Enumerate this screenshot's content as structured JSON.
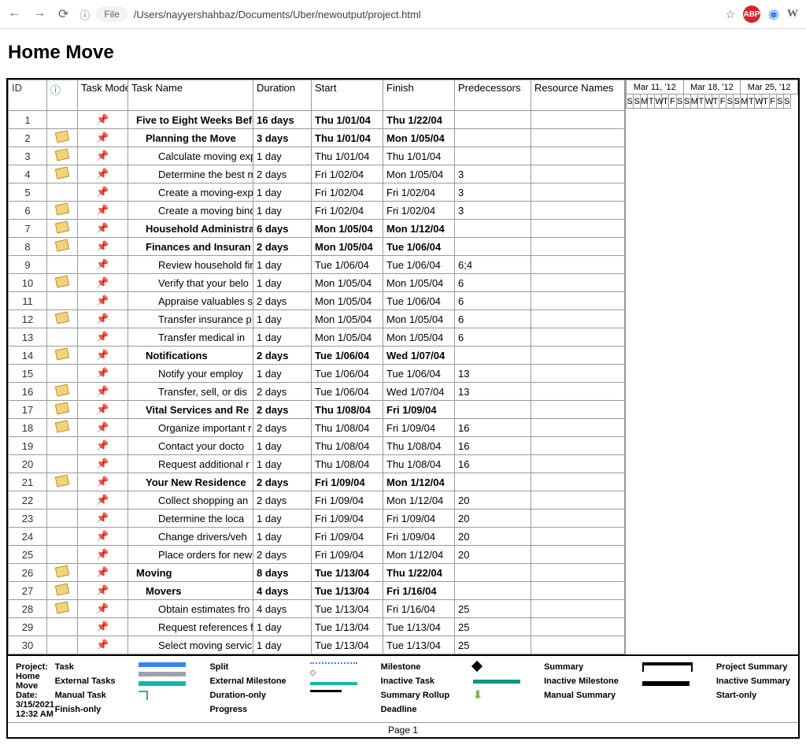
{
  "browser": {
    "file_chip": "File",
    "url": "/Users/nayyershahbaz/Documents/Uber/newoutput/project.html",
    "ext_abp": "ABP",
    "ext_w": "W"
  },
  "title": "Home Move",
  "columns": {
    "id": "ID",
    "info": "ⓘ",
    "mode": "Task Mode",
    "name": "Task Name",
    "duration": "Duration",
    "start": "Start",
    "finish": "Finish",
    "pred": "Predecessors",
    "res": "Resource Names"
  },
  "timeline": {
    "weeks": [
      "Mar 11, '12",
      "Mar 18, '12",
      "Mar 25, '12"
    ],
    "days": [
      "S",
      "S",
      "M",
      "T",
      "W",
      "T",
      "F",
      "S",
      "S",
      "M",
      "T",
      "W",
      "T",
      "F",
      "S",
      "S",
      "M",
      "T",
      "W",
      "T",
      "F",
      "S",
      "S"
    ]
  },
  "rows": [
    {
      "id": "1",
      "note": false,
      "bold": true,
      "indent": 1,
      "name": "Five to Eight Weeks Befo",
      "dur": "16 days",
      "start": "Thu 1/01/04",
      "finish": "Thu 1/22/04",
      "pred": ""
    },
    {
      "id": "2",
      "note": true,
      "bold": true,
      "indent": 2,
      "name": "Planning the Move",
      "dur": "3 days",
      "start": "Thu 1/01/04",
      "finish": "Mon 1/05/04",
      "pred": ""
    },
    {
      "id": "3",
      "note": true,
      "bold": false,
      "indent": 3,
      "name": "Calculate moving exp",
      "dur": "1 day",
      "start": "Thu 1/01/04",
      "finish": "Thu 1/01/04",
      "pred": ""
    },
    {
      "id": "4",
      "note": true,
      "bold": false,
      "indent": 3,
      "name": "Determine the best m",
      "dur": "2 days",
      "start": "Fri 1/02/04",
      "finish": "Mon 1/05/04",
      "pred": "3"
    },
    {
      "id": "5",
      "note": false,
      "bold": false,
      "indent": 3,
      "name": "Create a moving-expe",
      "dur": "1 day",
      "start": "Fri 1/02/04",
      "finish": "Fri 1/02/04",
      "pred": "3"
    },
    {
      "id": "6",
      "note": true,
      "bold": false,
      "indent": 3,
      "name": "Create a moving bind",
      "dur": "1 day",
      "start": "Fri 1/02/04",
      "finish": "Fri 1/02/04",
      "pred": "3"
    },
    {
      "id": "7",
      "note": true,
      "bold": true,
      "indent": 2,
      "name": "Household Administratio",
      "dur": "6 days",
      "start": "Mon 1/05/04",
      "finish": "Mon 1/12/04",
      "pred": ""
    },
    {
      "id": "8",
      "note": true,
      "bold": true,
      "indent": 2,
      "name": "Finances and Insuran",
      "dur": "2 days",
      "start": "Mon 1/05/04",
      "finish": "Tue 1/06/04",
      "pred": ""
    },
    {
      "id": "9",
      "note": false,
      "bold": false,
      "indent": 3,
      "name": "Review household fin",
      "dur": "1 day",
      "start": "Tue 1/06/04",
      "finish": "Tue 1/06/04",
      "pred": "6;4"
    },
    {
      "id": "10",
      "note": true,
      "bold": false,
      "indent": 3,
      "name": "Verify that your belo",
      "dur": "1 day",
      "start": "Mon 1/05/04",
      "finish": "Mon 1/05/04",
      "pred": "6"
    },
    {
      "id": "11",
      "note": false,
      "bold": false,
      "indent": 3,
      "name": "Appraise valuables s",
      "dur": "2 days",
      "start": "Mon 1/05/04",
      "finish": "Tue 1/06/04",
      "pred": "6"
    },
    {
      "id": "12",
      "note": true,
      "bold": false,
      "indent": 3,
      "name": "Transfer insurance p",
      "dur": "1 day",
      "start": "Mon 1/05/04",
      "finish": "Mon 1/05/04",
      "pred": "6"
    },
    {
      "id": "13",
      "note": false,
      "bold": false,
      "indent": 3,
      "name": "Transfer medical in",
      "dur": "1 day",
      "start": "Mon 1/05/04",
      "finish": "Mon 1/05/04",
      "pred": "6"
    },
    {
      "id": "14",
      "note": true,
      "bold": true,
      "indent": 2,
      "name": "Notifications",
      "dur": "2 days",
      "start": "Tue 1/06/04",
      "finish": "Wed 1/07/04",
      "pred": ""
    },
    {
      "id": "15",
      "note": false,
      "bold": false,
      "indent": 3,
      "name": "Notify your employ",
      "dur": "1 day",
      "start": "Tue 1/06/04",
      "finish": "Tue 1/06/04",
      "pred": "13"
    },
    {
      "id": "16",
      "note": true,
      "bold": false,
      "indent": 3,
      "name": "Transfer, sell, or dis",
      "dur": "2 days",
      "start": "Tue 1/06/04",
      "finish": "Wed 1/07/04",
      "pred": "13"
    },
    {
      "id": "17",
      "note": true,
      "bold": true,
      "indent": 2,
      "name": "Vital Services and Re",
      "dur": "2 days",
      "start": "Thu 1/08/04",
      "finish": "Fri 1/09/04",
      "pred": ""
    },
    {
      "id": "18",
      "note": true,
      "bold": false,
      "indent": 3,
      "name": "Organize important r",
      "dur": "2 days",
      "start": "Thu 1/08/04",
      "finish": "Fri 1/09/04",
      "pred": "16"
    },
    {
      "id": "19",
      "note": false,
      "bold": false,
      "indent": 3,
      "name": "Contact your docto",
      "dur": "1 day",
      "start": "Thu 1/08/04",
      "finish": "Thu 1/08/04",
      "pred": "16"
    },
    {
      "id": "20",
      "note": false,
      "bold": false,
      "indent": 3,
      "name": "Request additional r",
      "dur": "1 day",
      "start": "Thu 1/08/04",
      "finish": "Thu 1/08/04",
      "pred": "16"
    },
    {
      "id": "21",
      "note": true,
      "bold": true,
      "indent": 2,
      "name": "Your New Residence",
      "dur": "2 days",
      "start": "Fri 1/09/04",
      "finish": "Mon 1/12/04",
      "pred": ""
    },
    {
      "id": "22",
      "note": false,
      "bold": false,
      "indent": 3,
      "name": "Collect shopping an",
      "dur": "2 days",
      "start": "Fri 1/09/04",
      "finish": "Mon 1/12/04",
      "pred": "20"
    },
    {
      "id": "23",
      "note": false,
      "bold": false,
      "indent": 3,
      "name": "Determine the loca",
      "dur": "1 day",
      "start": "Fri 1/09/04",
      "finish": "Fri 1/09/04",
      "pred": "20"
    },
    {
      "id": "24",
      "note": false,
      "bold": false,
      "indent": 3,
      "name": "Change drivers/veh",
      "dur": "1 day",
      "start": "Fri 1/09/04",
      "finish": "Fri 1/09/04",
      "pred": "20"
    },
    {
      "id": "25",
      "note": false,
      "bold": false,
      "indent": 3,
      "name": "Place orders for new",
      "dur": "2 days",
      "start": "Fri 1/09/04",
      "finish": "Mon 1/12/04",
      "pred": "20"
    },
    {
      "id": "26",
      "note": true,
      "bold": true,
      "indent": 1,
      "name": "Moving",
      "dur": "8 days",
      "start": "Tue 1/13/04",
      "finish": "Thu 1/22/04",
      "pred": ""
    },
    {
      "id": "27",
      "note": true,
      "bold": true,
      "indent": 2,
      "name": "Movers",
      "dur": "4 days",
      "start": "Tue 1/13/04",
      "finish": "Fri 1/16/04",
      "pred": ""
    },
    {
      "id": "28",
      "note": true,
      "bold": false,
      "indent": 3,
      "name": "Obtain estimates fro",
      "dur": "4 days",
      "start": "Tue 1/13/04",
      "finish": "Fri 1/16/04",
      "pred": "25"
    },
    {
      "id": "29",
      "note": false,
      "bold": false,
      "indent": 3,
      "name": "Request references f",
      "dur": "1 day",
      "start": "Tue 1/13/04",
      "finish": "Tue 1/13/04",
      "pred": "25"
    },
    {
      "id": "30",
      "note": false,
      "bold": false,
      "indent": 3,
      "name": "Select moving servic",
      "dur": "1 day",
      "start": "Tue 1/13/04",
      "finish": "Tue 1/13/04",
      "pred": "25"
    }
  ],
  "legend": {
    "project_label": "Project: Home Move",
    "date_label": "Date: 3/15/2021 12:32 AM",
    "task": "Task",
    "external_tasks": "External Tasks",
    "manual_task": "Manual Task",
    "finish_only": "Finish-only",
    "split": "Split",
    "external_milestone": "External Milestone",
    "duration_only": "Duration-only",
    "progress": "Progress",
    "milestone": "Milestone",
    "inactive_task": "Inactive Task",
    "summary_rollup": "Summary Rollup",
    "deadline": "Deadline",
    "summary": "Summary",
    "inactive_milestone": "Inactive Milestone",
    "manual_summary": "Manual Summary",
    "project_summary": "Project Summary",
    "inactive_summary": "Inactive Summary",
    "start_only": "Start-only"
  },
  "page_number": "Page 1"
}
